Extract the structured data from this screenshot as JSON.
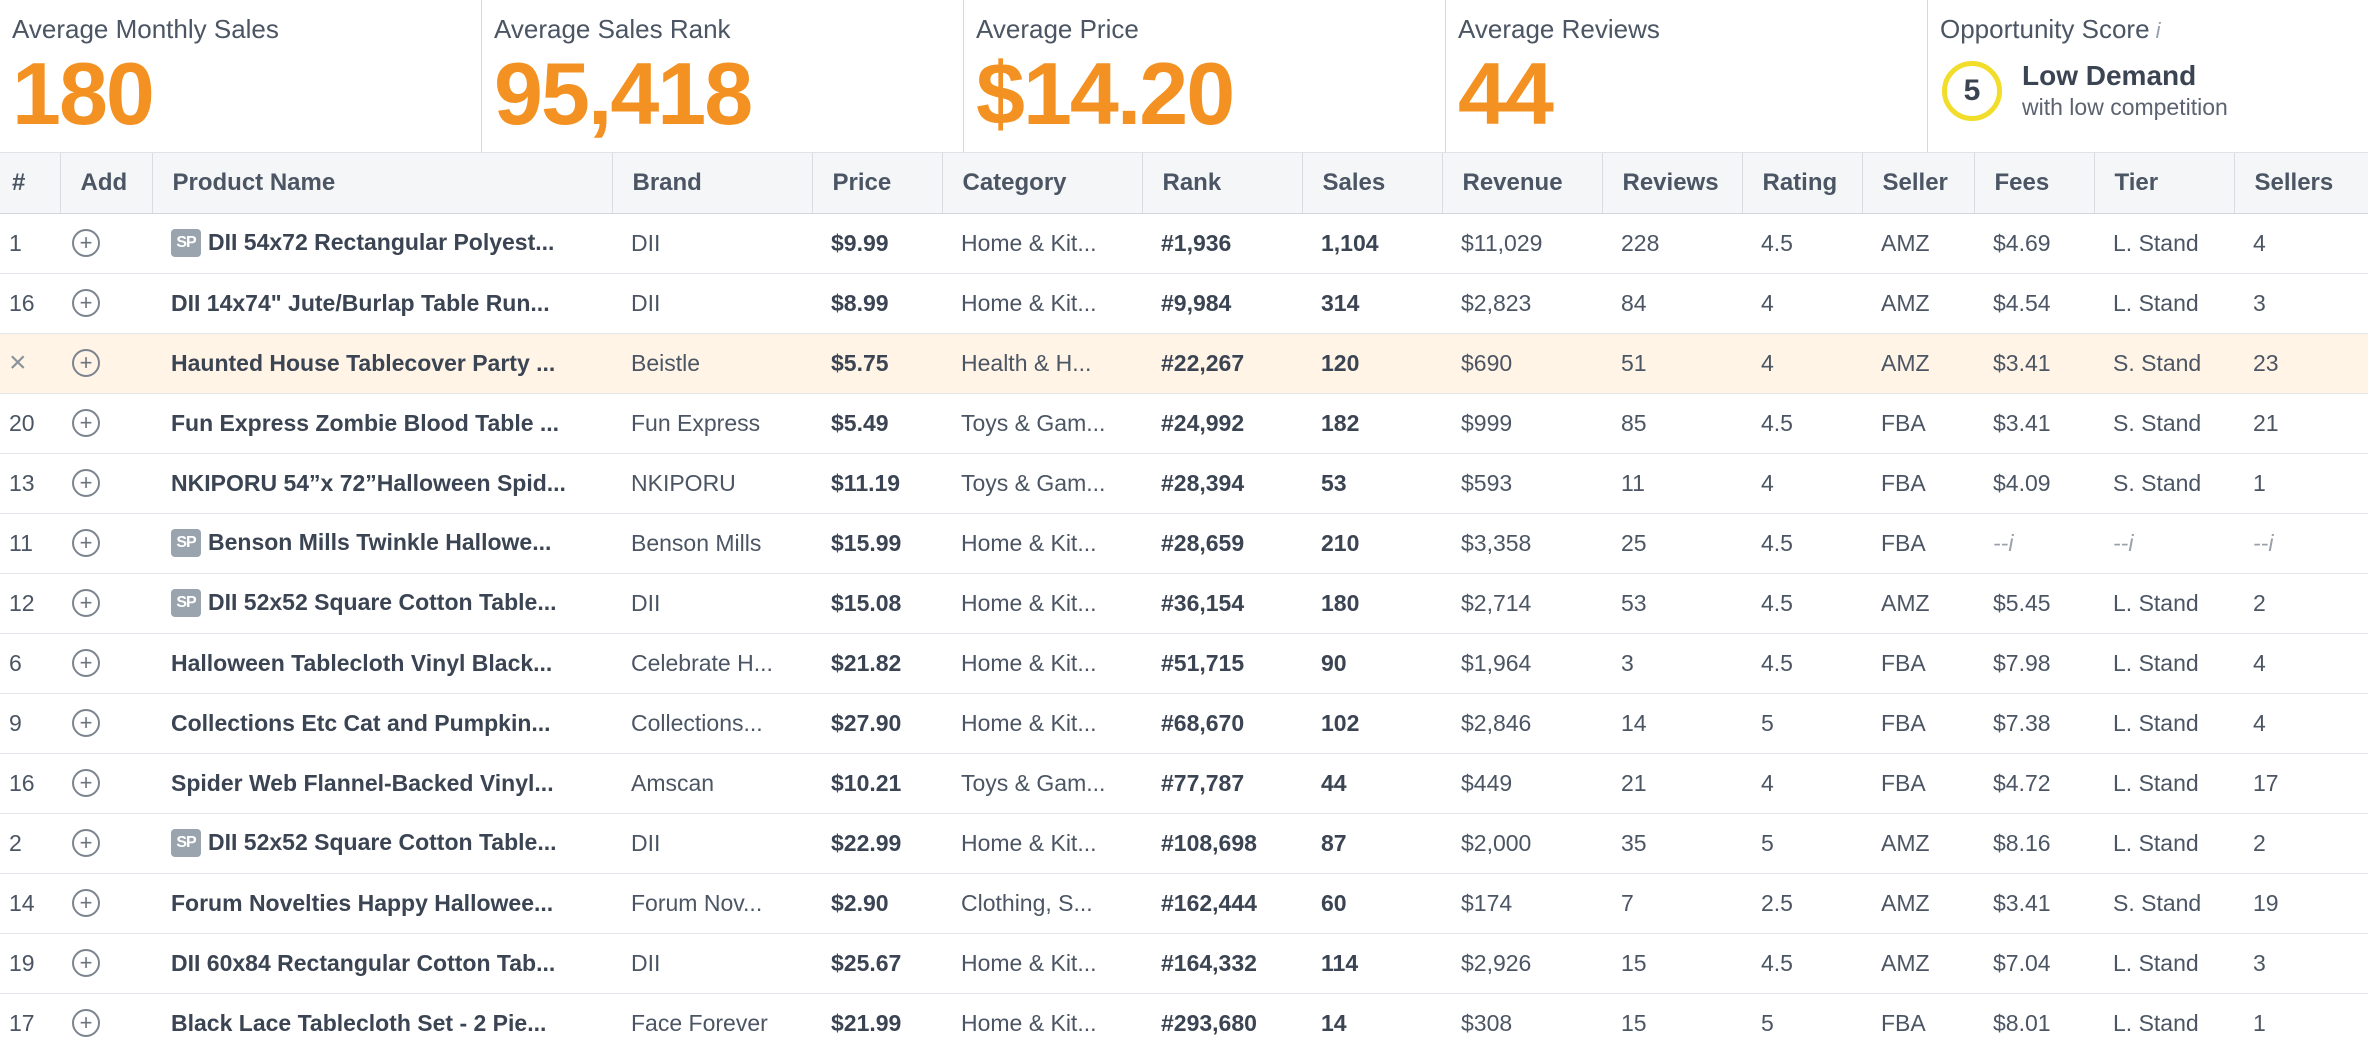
{
  "summary": {
    "avg_monthly_sales": {
      "label": "Average Monthly Sales",
      "value": "180"
    },
    "avg_sales_rank": {
      "label": "Average Sales Rank",
      "value": "95,418"
    },
    "avg_price": {
      "label": "Average Price",
      "value": "$14.20"
    },
    "avg_reviews": {
      "label": "Average Reviews",
      "value": "44"
    },
    "opportunity": {
      "label": "Opportunity Score",
      "info": "i",
      "score": "5",
      "main": "Low Demand",
      "sub": "with low competition"
    }
  },
  "colors": {
    "accent": "#f39222",
    "score_ring": "#f2dd2a",
    "highlight_row": "#fff4e6"
  },
  "table": {
    "headers": [
      "#",
      "Add",
      "Product Name",
      "Brand",
      "Price",
      "Category",
      "Rank",
      "Sales",
      "Revenue",
      "Reviews",
      "Rating",
      "Seller",
      "Fees",
      "Tier",
      "Sellers"
    ],
    "add_icon": "plus-circle-icon",
    "rows": [
      {
        "num": "1",
        "sp": true,
        "name": "DII 54x72 Rectangular Polyest...",
        "brand": "DII",
        "price": "$9.99",
        "category": "Home & Kit...",
        "rank": "#1,936",
        "sales": "1,104",
        "revenue": "$11,029",
        "reviews": "228",
        "rating": "4.5",
        "seller": "AMZ",
        "fees": "$4.69",
        "tier": "L. Stand",
        "sellers": "4"
      },
      {
        "num": "16",
        "sp": false,
        "name": "DII 14x74\" Jute/Burlap Table Run...",
        "brand": "DII",
        "price": "$8.99",
        "category": "Home & Kit...",
        "rank": "#9,984",
        "sales": "314",
        "revenue": "$2,823",
        "reviews": "84",
        "rating": "4",
        "seller": "AMZ",
        "fees": "$4.54",
        "tier": "L. Stand",
        "sellers": "3"
      },
      {
        "num": "×",
        "highlight": true,
        "sp": false,
        "name": "Haunted House Tablecover Party ...",
        "brand": "Beistle",
        "price": "$5.75",
        "category": "Health & H...",
        "rank": "#22,267",
        "sales": "120",
        "revenue": "$690",
        "reviews": "51",
        "rating": "4",
        "seller": "AMZ",
        "fees": "$3.41",
        "tier": "S. Stand",
        "sellers": "23"
      },
      {
        "num": "20",
        "sp": false,
        "name": "Fun Express Zombie Blood Table ...",
        "brand": "Fun Express",
        "price": "$5.49",
        "category": "Toys & Gam...",
        "rank": "#24,992",
        "sales": "182",
        "revenue": "$999",
        "reviews": "85",
        "rating": "4.5",
        "seller": "FBA",
        "fees": "$3.41",
        "tier": "S. Stand",
        "sellers": "21"
      },
      {
        "num": "13",
        "sp": false,
        "name": "NKIPORU 54”x 72”Halloween Spid...",
        "brand": "NKIPORU",
        "price": "$11.19",
        "category": "Toys & Gam...",
        "rank": "#28,394",
        "sales": "53",
        "revenue": "$593",
        "reviews": "11",
        "rating": "4",
        "seller": "FBA",
        "fees": "$4.09",
        "tier": "S. Stand",
        "sellers": "1"
      },
      {
        "num": "11",
        "sp": true,
        "name": "Benson Mills Twinkle Hallowe...",
        "brand": "Benson Mills",
        "price": "$15.99",
        "category": "Home & Kit...",
        "rank": "#28,659",
        "sales": "210",
        "revenue": "$3,358",
        "reviews": "25",
        "rating": "4.5",
        "seller": "FBA",
        "fees": "--i",
        "tier": "--i",
        "sellers": "--i",
        "missing": true
      },
      {
        "num": "12",
        "sp": true,
        "name": "DII 52x52 Square Cotton Table...",
        "brand": "DII",
        "price": "$15.08",
        "category": "Home & Kit...",
        "rank": "#36,154",
        "sales": "180",
        "revenue": "$2,714",
        "reviews": "53",
        "rating": "4.5",
        "seller": "AMZ",
        "fees": "$5.45",
        "tier": "L. Stand",
        "sellers": "2"
      },
      {
        "num": "6",
        "sp": false,
        "name": "Halloween Tablecloth Vinyl Black...",
        "brand": "Celebrate H...",
        "price": "$21.82",
        "category": "Home & Kit...",
        "rank": "#51,715",
        "sales": "90",
        "revenue": "$1,964",
        "reviews": "3",
        "rating": "4.5",
        "seller": "FBA",
        "fees": "$7.98",
        "tier": "L. Stand",
        "sellers": "4"
      },
      {
        "num": "9",
        "sp": false,
        "name": "Collections Etc Cat and Pumpkin...",
        "brand": "Collections...",
        "price": "$27.90",
        "category": "Home & Kit...",
        "rank": "#68,670",
        "sales": "102",
        "revenue": "$2,846",
        "reviews": "14",
        "rating": "5",
        "seller": "FBA",
        "fees": "$7.38",
        "tier": "L. Stand",
        "sellers": "4"
      },
      {
        "num": "16",
        "sp": false,
        "name": "Spider Web Flannel-Backed Vinyl...",
        "brand": "Amscan",
        "price": "$10.21",
        "category": "Toys & Gam...",
        "rank": "#77,787",
        "sales": "44",
        "revenue": "$449",
        "reviews": "21",
        "rating": "4",
        "seller": "FBA",
        "fees": "$4.72",
        "tier": "L. Stand",
        "sellers": "17"
      },
      {
        "num": "2",
        "sp": true,
        "name": "DII 52x52 Square Cotton Table...",
        "brand": "DII",
        "price": "$22.99",
        "category": "Home & Kit...",
        "rank": "#108,698",
        "sales": "87",
        "revenue": "$2,000",
        "reviews": "35",
        "rating": "5",
        "seller": "AMZ",
        "fees": "$8.16",
        "tier": "L. Stand",
        "sellers": "2"
      },
      {
        "num": "14",
        "sp": false,
        "name": "Forum Novelties Happy Hallowee...",
        "brand": "Forum Nov...",
        "price": "$2.90",
        "category": "Clothing, S...",
        "rank": "#162,444",
        "sales": "60",
        "revenue": "$174",
        "reviews": "7",
        "rating": "2.5",
        "seller": "AMZ",
        "fees": "$3.41",
        "tier": "S. Stand",
        "sellers": "19"
      },
      {
        "num": "19",
        "sp": false,
        "name": "DII 60x84 Rectangular Cotton Tab...",
        "brand": "DII",
        "price": "$25.67",
        "category": "Home & Kit...",
        "rank": "#164,332",
        "sales": "114",
        "revenue": "$2,926",
        "reviews": "15",
        "rating": "4.5",
        "seller": "AMZ",
        "fees": "$7.04",
        "tier": "L. Stand",
        "sellers": "3"
      },
      {
        "num": "17",
        "sp": false,
        "name": "Black Lace Tablecloth Set - 2 Pie...",
        "brand": "Face Forever",
        "price": "$21.99",
        "category": "Home & Kit...",
        "rank": "#293,680",
        "sales": "14",
        "revenue": "$308",
        "reviews": "15",
        "rating": "5",
        "seller": "FBA",
        "fees": "$8.01",
        "tier": "L. Stand",
        "sellers": "1"
      }
    ],
    "sp_badge": "SP"
  }
}
